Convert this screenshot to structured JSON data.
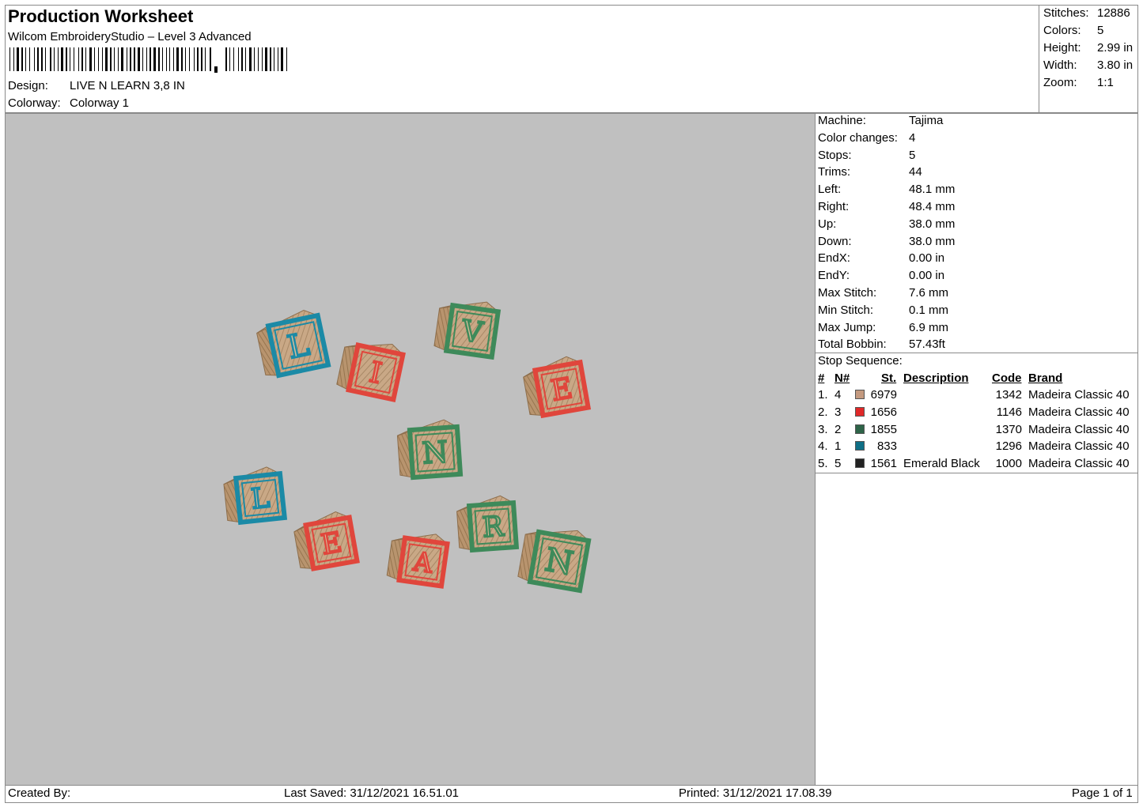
{
  "header": {
    "title": "Production Worksheet",
    "subtitle": "Wilcom EmbroideryStudio – Level 3 Advanced",
    "design_label": "Design:",
    "design_value": "LIVE N LEARN 3,8 IN",
    "colorway_label": "Colorway:",
    "colorway_value": "Colorway 1"
  },
  "stats": [
    {
      "label": "Stitches:",
      "value": "12886"
    },
    {
      "label": "Colors:",
      "value": "5"
    },
    {
      "label": "Height:",
      "value": "2.99 in"
    },
    {
      "label": "Width:",
      "value": "3.80 in"
    },
    {
      "label": "Zoom:",
      "value": "1:1"
    }
  ],
  "info": [
    {
      "label": "Machine:",
      "value": "Tajima"
    },
    {
      "label": "Color changes:",
      "value": "4"
    },
    {
      "label": "Stops:",
      "value": "5"
    },
    {
      "label": "Trims:",
      "value": "44"
    },
    {
      "label": "Left:",
      "value": "48.1 mm"
    },
    {
      "label": "Right:",
      "value": "48.4 mm"
    },
    {
      "label": "Up:",
      "value": "38.0 mm"
    },
    {
      "label": "Down:",
      "value": "38.0 mm"
    },
    {
      "label": "EndX:",
      "value": "0.00 in"
    },
    {
      "label": "EndY:",
      "value": "0.00 in"
    },
    {
      "label": "Max Stitch:",
      "value": "7.6 mm"
    },
    {
      "label": "Min Stitch:",
      "value": "0.1 mm"
    },
    {
      "label": "Max Jump:",
      "value": "6.9 mm"
    },
    {
      "label": "Total Bobbin:",
      "value": "57.43ft"
    }
  ],
  "stop_sequence": {
    "title": "Stop Sequence:",
    "headers": {
      "num": "#",
      "n": "N#",
      "st": "St.",
      "description": "Description",
      "code": "Code",
      "brand": "Brand"
    },
    "rows": [
      {
        "num": "1.",
        "n": "4",
        "color": "#c49a80",
        "st": "6979",
        "description": "",
        "code": "1342",
        "brand": "Madeira Classic 40"
      },
      {
        "num": "2.",
        "n": "3",
        "color": "#e02828",
        "st": "1656",
        "description": "",
        "code": "1146",
        "brand": "Madeira Classic 40"
      },
      {
        "num": "3.",
        "n": "2",
        "color": "#2e6448",
        "st": "1855",
        "description": "",
        "code": "1370",
        "brand": "Madeira Classic 40"
      },
      {
        "num": "4.",
        "n": "1",
        "color": "#0f6f86",
        "st": "833",
        "description": "",
        "code": "1296",
        "brand": "Madeira Classic 40"
      },
      {
        "num": "5.",
        "n": "5",
        "color": "#222222",
        "st": "1561",
        "description": "Emerald Black",
        "code": "1000",
        "brand": "Madeira Classic 40"
      }
    ]
  },
  "blocks": [
    {
      "letter": "L",
      "color": "#1b8aa6"
    },
    {
      "letter": "I",
      "color": "#e0463c"
    },
    {
      "letter": "V",
      "color": "#3e8a5a"
    },
    {
      "letter": "E",
      "color": "#e0463c"
    },
    {
      "letter": "N",
      "color": "#3e8a5a"
    },
    {
      "letter": "L",
      "color": "#1b8aa6"
    },
    {
      "letter": "E",
      "color": "#e0463c"
    },
    {
      "letter": "A",
      "color": "#e0463c"
    },
    {
      "letter": "R",
      "color": "#3e8a5a"
    },
    {
      "letter": "N",
      "color": "#3e8a5a"
    }
  ],
  "footer": {
    "created_by": "Created By:",
    "last_saved": "Last Saved: 31/12/2021 16.51.01",
    "printed": "Printed: 31/12/2021 17.08.39",
    "page": "Page 1 of 1"
  }
}
